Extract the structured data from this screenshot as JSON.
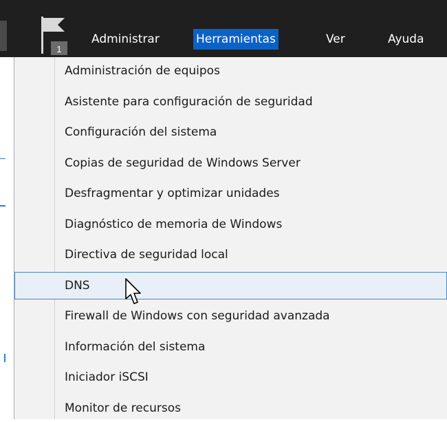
{
  "menubar": {
    "notification_count": "1",
    "items": [
      {
        "label": "Administrar"
      },
      {
        "label": "Herramientas"
      },
      {
        "label": "Ver"
      },
      {
        "label": "Ayuda"
      }
    ]
  },
  "dropdown": {
    "hovered_item": "DNS",
    "items": [
      {
        "label": "Administración de equipos"
      },
      {
        "label": "Asistente para configuración de seguridad"
      },
      {
        "label": "Configuración del sistema"
      },
      {
        "label": "Copias de seguridad de Windows Server"
      },
      {
        "label": "Desfragmentar y optimizar unidades"
      },
      {
        "label": "Diagnóstico de memoria de Windows"
      },
      {
        "label": "Directiva de seguridad local"
      },
      {
        "label": "DNS"
      },
      {
        "label": "Firewall de Windows con seguridad avanzada"
      },
      {
        "label": "Información del sistema"
      },
      {
        "label": "Iniciador iSCSI"
      },
      {
        "label": "Monitor de recursos"
      }
    ]
  },
  "colors": {
    "menubar_bg": "#1f1f1f",
    "active_menu_bg": "#0b62c6",
    "dropdown_bg": "#f2f2f2",
    "hover_border": "#4a86c5"
  }
}
